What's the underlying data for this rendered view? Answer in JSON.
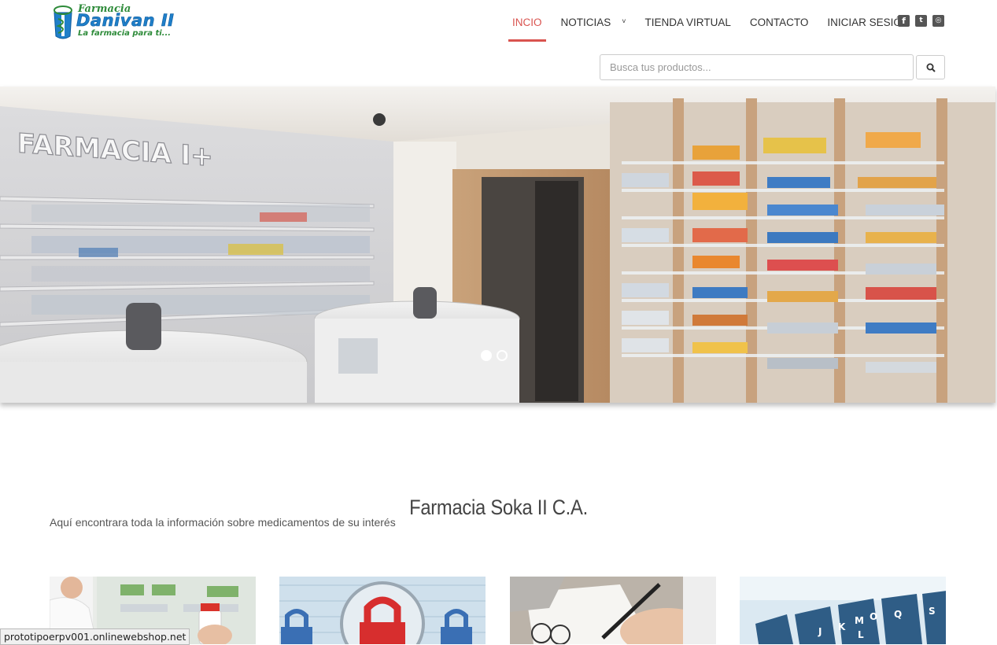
{
  "brand": {
    "line1": "Farmacia",
    "line2": "Danivan II",
    "tagline": "La farmacia para ti..."
  },
  "nav": {
    "items": [
      {
        "label": "INCIO",
        "active": true
      },
      {
        "label": "NOTICIAS",
        "has_dropdown": true,
        "caret": "˅"
      },
      {
        "label": "TIENDA VIRTUAL"
      },
      {
        "label": "CONTACTO"
      },
      {
        "label": "INICIAR SESIÓN"
      }
    ],
    "active_color": "#d9534f"
  },
  "social": {
    "facebook": "facebook-icon",
    "twitter": "twitter-icon",
    "instagram": "instagram-icon"
  },
  "search": {
    "placeholder": "Busca tus productos...",
    "value": "",
    "button_icon": "search-icon"
  },
  "hero": {
    "sign_text": "FARMACIA I+",
    "slides_count": 2,
    "active_slide": 1
  },
  "section": {
    "title": "Farmacia Soka II C.A.",
    "subtitle": "Aquí encontrara toda la información sobre medicamentos de su interés"
  },
  "cards": [
    {
      "image": "pharmacist-image"
    },
    {
      "image": "padlock-image"
    },
    {
      "image": "writing-hand-image"
    },
    {
      "image": "file-index-image",
      "letters": [
        "M",
        "O",
        "Q",
        "S",
        "K",
        "L",
        "J"
      ]
    }
  ],
  "status_url": "prototipoerpv001.onlinewebshop.net"
}
